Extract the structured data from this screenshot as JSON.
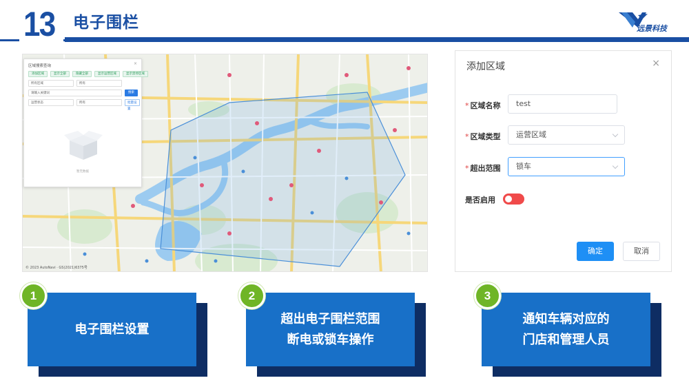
{
  "header": {
    "number": "13",
    "title": "电子围栏",
    "logo_text": "远景科技",
    "brand_color": "#1a4fa3"
  },
  "map": {
    "attribution": "© 2023 AutoNavi · GS(2021)6375号",
    "query_panel": {
      "title": "区域搜索查询",
      "buttons": [
        "添加区域",
        "显示全部",
        "隐藏全部",
        "显示运营区域",
        "显示禁停区域"
      ],
      "row1": [
        "所有区域",
        "所有"
      ],
      "keyword_placeholder": "请输入关键词",
      "search_label": "搜索",
      "row2": [
        "运营状态",
        "所有"
      ],
      "show_label": "批量设置",
      "empty_text": "暂无数据"
    }
  },
  "dialog": {
    "title": "添加区域",
    "close": "×",
    "fields": [
      {
        "label": "区域名称",
        "required": true,
        "value": "test"
      },
      {
        "label": "区域类型",
        "required": true,
        "value": "运营区域"
      },
      {
        "label": "超出范围",
        "required": true,
        "value": "锁车"
      }
    ],
    "toggle_label": "是否启用",
    "toggle_on": false,
    "ok_label": "确定",
    "cancel_label": "取消"
  },
  "steps": [
    {
      "num": "1",
      "lines": [
        "电子围栏设置"
      ]
    },
    {
      "num": "2",
      "lines": [
        "超出电子围栏范围",
        "断电或锁车操作"
      ]
    },
    {
      "num": "3",
      "lines": [
        "通知车辆对应的",
        "门店和管理人员"
      ]
    }
  ],
  "colors": {
    "card": "#1870c8",
    "card_shadow": "#0e2d63",
    "badge": "#6fb526",
    "primary_button": "#1e8ff5",
    "toggle": "#f04a4a"
  }
}
